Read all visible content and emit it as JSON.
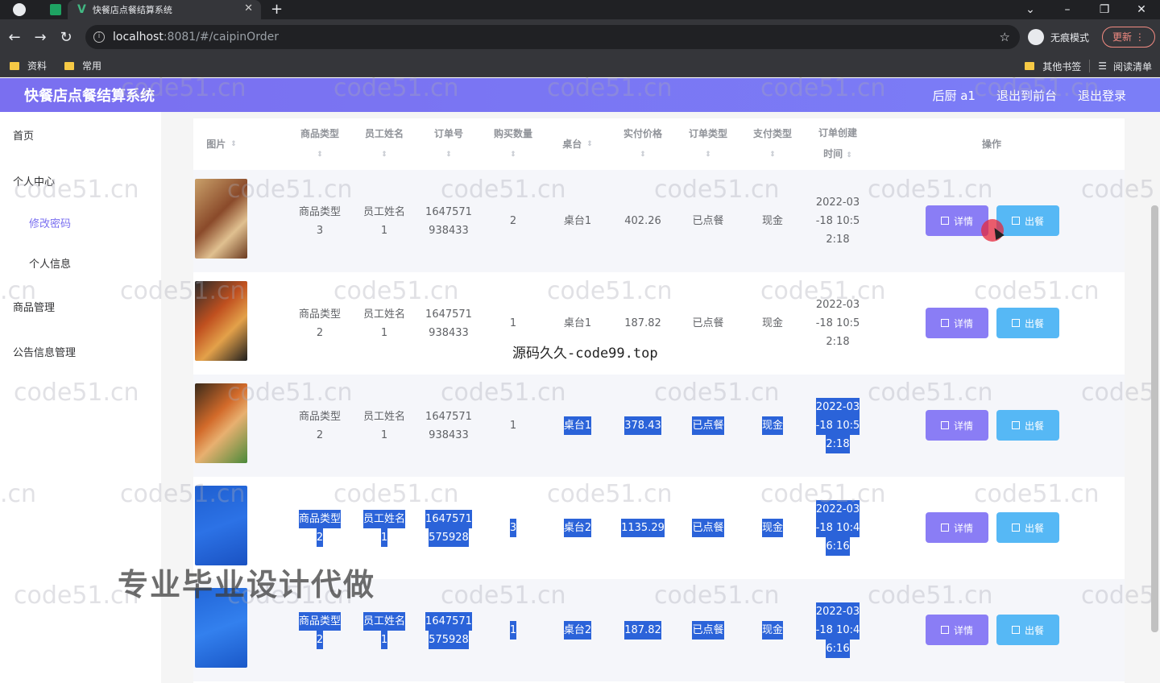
{
  "browser": {
    "tab_title": "快餐店点餐结算系统",
    "url_host": "localhost",
    "url_rest": ":8081/#/caipinOrder",
    "incognito_label": "无痕模式",
    "update_label": "更新",
    "bookmarks": [
      "资料",
      "常用"
    ],
    "bookmarks_right": [
      "其他书签",
      "阅读清单"
    ]
  },
  "header": {
    "title": "快餐店点餐结算系统",
    "user": "后厨 a1",
    "front_link": "退出到前台",
    "logout": "退出登录"
  },
  "sidebar": {
    "home": "首页",
    "personal_center": "个人中心",
    "change_password": "修改密码",
    "personal_info": "个人信息",
    "goods_mgmt": "商品管理",
    "notice_mgmt": "公告信息管理"
  },
  "table": {
    "headers": {
      "pic": "图片",
      "type": "商品类型",
      "staff": "员工姓名",
      "order_no": "订单号",
      "qty": "购买数量",
      "table": "桌台",
      "price": "实付价格",
      "order_type": "订单类型",
      "pay_type": "支付类型",
      "created_1": "订单创建",
      "created_2": "时间",
      "ops": "操作"
    },
    "detail_label": "详情",
    "serve_label": "出餐",
    "rows": [
      {
        "type1": "商品类型",
        "type2": "3",
        "staff1": "员工姓名",
        "staff2": "1",
        "no1": "1647571",
        "no2": "938433",
        "qty": "2",
        "table": "桌台1",
        "price": "402.26",
        "otype": "已点餐",
        "ptype": "现金",
        "t1": "2022-03",
        "t2": "-18 10:5",
        "t3": "2:18"
      },
      {
        "type1": "商品类型",
        "type2": "2",
        "staff1": "员工姓名",
        "staff2": "1",
        "no1": "1647571",
        "no2": "938433",
        "qty": "1",
        "table": "桌台1",
        "price": "187.82",
        "otype": "已点餐",
        "ptype": "现金",
        "t1": "2022-03",
        "t2": "-18 10:5",
        "t3": "2:18"
      },
      {
        "type1": "商品类型",
        "type2": "2",
        "staff1": "员工姓名",
        "staff2": "1",
        "no1": "1647571",
        "no2": "938433",
        "qty": "1",
        "table": "桌台1",
        "price": "378.43",
        "otype": "已点餐",
        "ptype": "现金",
        "t1": "2022-03",
        "t2": "-18 10:5",
        "t3": "2:18"
      },
      {
        "type1": "商品类型",
        "type2": "2",
        "staff1": "员工姓名",
        "staff2": "1",
        "no1": "1647571",
        "no2": "575928",
        "qty": "3",
        "table": "桌台2",
        "price": "1135.29",
        "otype": "已点餐",
        "ptype": "现金",
        "t1": "2022-03",
        "t2": "-18 10:4",
        "t3": "6:16"
      },
      {
        "type1": "商品类型",
        "type2": "2",
        "staff1": "员工姓名",
        "staff2": "1",
        "no1": "1647571",
        "no2": "575928",
        "qty": "1",
        "table": "桌台2",
        "price": "187.82",
        "otype": "已点餐",
        "ptype": "现金",
        "t1": "2022-03",
        "t2": "-18 10:4",
        "t3": "6:16"
      }
    ]
  },
  "overlays": {
    "watermark": "code51.cn",
    "watermark_short": ".cn",
    "watermark_cut": "code5",
    "source_text": "源码久久-code99.top",
    "banner": "专业毕业设计代做"
  },
  "colors": {
    "header_bg": "#7a6ff0",
    "detail_btn": "#8a7df5",
    "serve_btn": "#56b8f5",
    "selection": "#2b63d9"
  }
}
